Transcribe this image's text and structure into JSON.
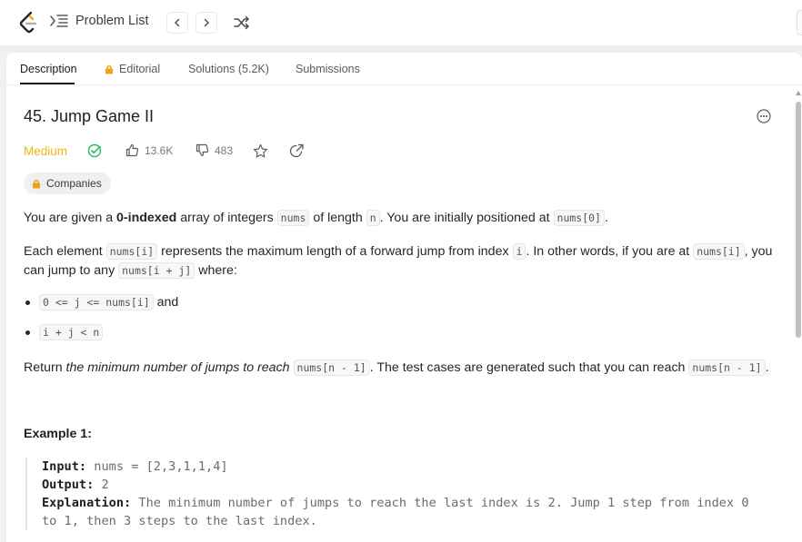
{
  "topbar": {
    "problem_list_label": "Problem List"
  },
  "tabs": [
    {
      "label": "Description",
      "active": true
    },
    {
      "label": "Editorial",
      "locked": true
    },
    {
      "label": "Solutions (5.2K)"
    },
    {
      "label": "Submissions"
    }
  ],
  "problem": {
    "title": "45. Jump Game II",
    "difficulty": "Medium",
    "likes": "13.6K",
    "dislikes": "483",
    "companies_label": "Companies",
    "p1": {
      "t1": "You are given a ",
      "b1": "0-indexed",
      "t2": " array of integers ",
      "c1": "nums",
      "t3": " of length ",
      "c2": "n",
      "t4": ". You are initially positioned at ",
      "c3": "nums[0]",
      "t5": "."
    },
    "p2": {
      "t1": "Each element ",
      "c1": "nums[i]",
      "t2": " represents the maximum length of a forward jump from index ",
      "c2": "i",
      "t3": ". In other words, if you are at ",
      "c3": "nums[i]",
      "t4": ", you can jump to any ",
      "c4": "nums[i + j]",
      "t5": " where:"
    },
    "bullets": [
      {
        "code": "0 <= j <= nums[i]",
        "suffix": " and"
      },
      {
        "code": "i + j < n",
        "suffix": ""
      }
    ],
    "p3": {
      "t1": "Return ",
      "i1": "the minimum number of jumps to reach",
      "t2": " ",
      "c1": "nums[n - 1]",
      "t3": ". The test cases are generated such that you can reach ",
      "c2": "nums[n - 1]",
      "t4": "."
    },
    "example1": {
      "title": "Example 1:",
      "input_label": "Input:",
      "input_value": " nums = [2,3,1,1,4]",
      "output_label": "Output:",
      "output_value": " 2",
      "explanation_label": "Explanation:",
      "explanation_line1": " The minimum number of jumps to reach the last index is 2. Jump 1 step from index 0",
      "explanation_line2": "to 1, then 3 steps to the last index."
    }
  },
  "colors": {
    "difficulty_medium": "#f0b50b",
    "solved_check": "#2cbb5d",
    "logo_orange": "#ffa116"
  }
}
